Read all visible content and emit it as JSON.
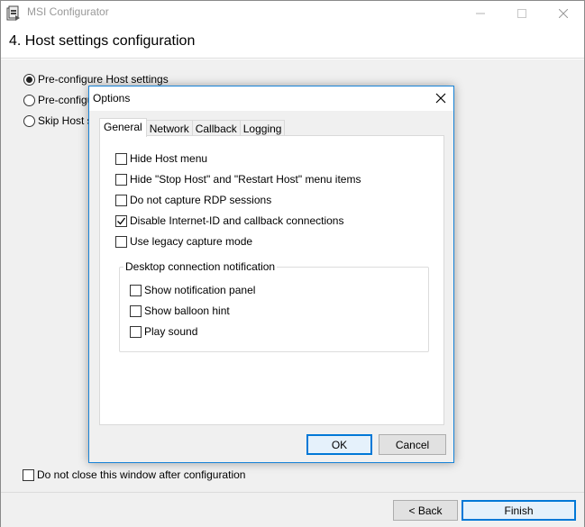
{
  "window": {
    "title": "MSI Configurator",
    "page_title": "4. Host settings configuration"
  },
  "main": {
    "radios": [
      {
        "label": "Pre-configure Host settings",
        "checked": true
      },
      {
        "label": "Pre-configure",
        "checked": false
      },
      {
        "label": "Skip Host se",
        "checked": false
      }
    ],
    "keep_open_label": "Do not close this window after configuration"
  },
  "footer": {
    "back_label": "< Back",
    "finish_label": "Finish"
  },
  "dialog": {
    "title": "Options",
    "tabs": [
      "General",
      "Network",
      "Callback",
      "Logging"
    ],
    "active_tab": "General",
    "options": [
      {
        "label": "Hide Host menu",
        "checked": false
      },
      {
        "label": "Hide \"Stop Host\" and \"Restart Host\" menu items",
        "checked": false
      },
      {
        "label": "Do not capture RDP sessions",
        "checked": false
      },
      {
        "label": "Disable Internet-ID and callback connections",
        "checked": true
      },
      {
        "label": "Use legacy capture mode",
        "checked": false
      }
    ],
    "group": {
      "label": "Desktop connection notification",
      "options": [
        {
          "label": "Show notification panel",
          "checked": false
        },
        {
          "label": "Show balloon hint",
          "checked": false
        },
        {
          "label": "Play sound",
          "checked": false
        }
      ]
    },
    "ok_label": "OK",
    "cancel_label": "Cancel"
  },
  "colors": {
    "accent": "#0078d7",
    "dialog_border": "#1883d7"
  },
  "icons": {
    "app": "msi-installer-icon",
    "close": "close-icon",
    "minimize": "minimize-icon",
    "maximize": "maximize-icon",
    "check": "check-icon"
  }
}
